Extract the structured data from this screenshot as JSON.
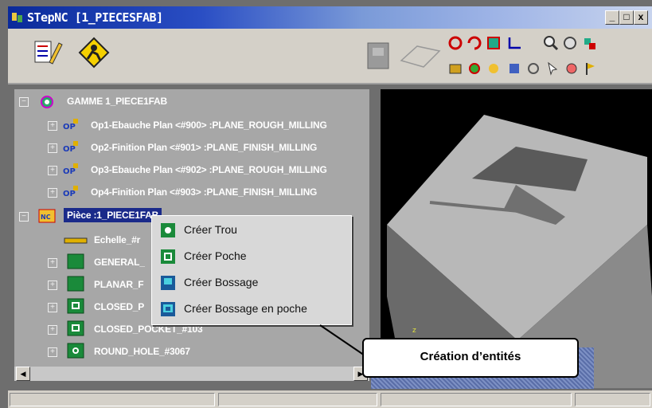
{
  "window": {
    "title": "STepNC [1_PIECESFAB]",
    "controls": {
      "minimize": "_",
      "maximize": "□",
      "close": "x"
    }
  },
  "toolbar": {
    "left_icons": [
      "edit-list-icon",
      "worker-sign-icon"
    ],
    "right_icons": [
      "machine-icon",
      "part-outline-icon",
      "refresh-icon",
      "rotate-icon",
      "select-icon",
      "axes-icon",
      "zoom-icon",
      "view-icon",
      "paint-icon"
    ]
  },
  "tree": {
    "root": {
      "label": "GAMME 1_PIECE1FAB"
    },
    "operations": [
      {
        "label": "Op1-Ebauche Plan <#900> :PLANE_ROUGH_MILLING"
      },
      {
        "label": "Op2-Finition Plan <#901> :PLANE_FINISH_MILLING"
      },
      {
        "label": "Op3-Ebauche Plan <#902> :PLANE_ROUGH_MILLING"
      },
      {
        "label": "Op4-Finition Plan <#903> :PLANE_FINISH_MILLING"
      }
    ],
    "piece": {
      "label": "Pièce :1_PIECE1FAB"
    },
    "features": [
      {
        "label": "Echelle_#r"
      },
      {
        "label": "GENERAL_"
      },
      {
        "label": "PLANAR_F"
      },
      {
        "label": "CLOSED_P"
      },
      {
        "label": "CLOSED_POCKET_#103"
      },
      {
        "label": "ROUND_HOLE_#3067"
      }
    ]
  },
  "context_menu": {
    "items": [
      {
        "label": "Créer Trou"
      },
      {
        "label": "Créer Poche"
      },
      {
        "label": "Créer Bossage"
      },
      {
        "label": "Créer Bossage en poche"
      }
    ]
  },
  "callout": {
    "text": "Création d’entités"
  },
  "viewport": {
    "marker": "z"
  },
  "colors": {
    "tree_bg": "#a7a7a7",
    "selection": "#1a2a8a",
    "view_bg": "#000000"
  }
}
